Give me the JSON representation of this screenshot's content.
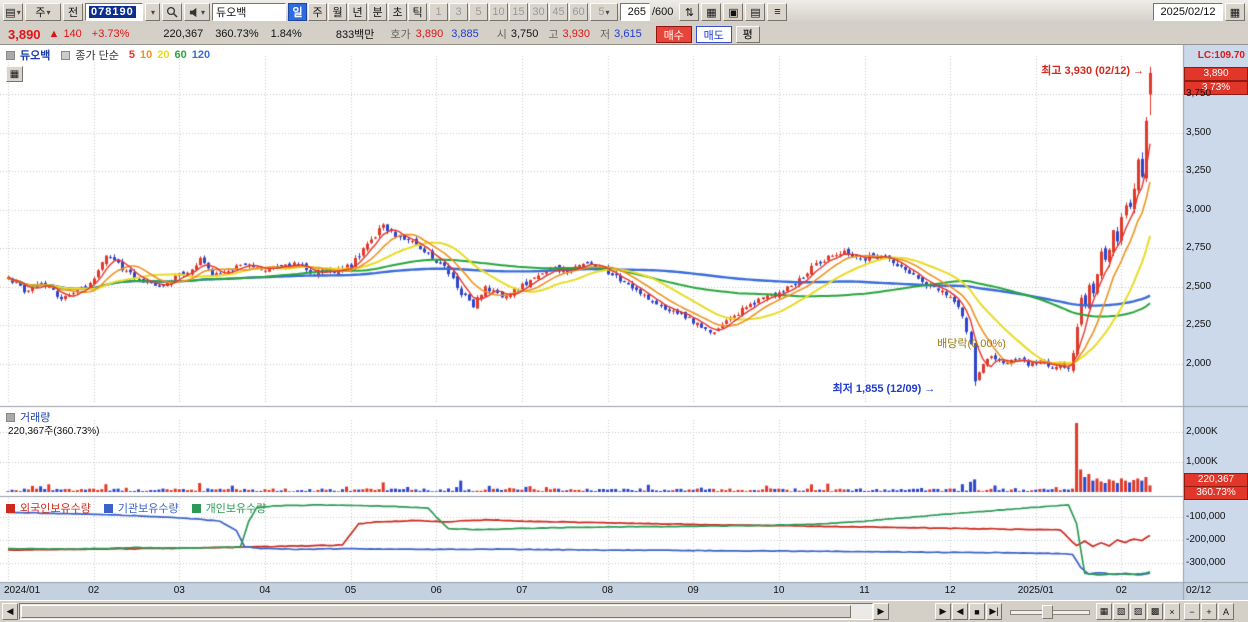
{
  "toolbar": {
    "menu_glyph": "▤",
    "period_combo": "주",
    "prev_label": "전",
    "code_value": "078190",
    "stock_name": "듀오백",
    "period_tabs": [
      {
        "label": "일",
        "active": true
      },
      {
        "label": "주",
        "active": false
      },
      {
        "label": "월",
        "active": false
      },
      {
        "label": "년",
        "active": false
      },
      {
        "label": "분",
        "active": false
      },
      {
        "label": "초",
        "active": false
      },
      {
        "label": "틱",
        "active": false
      }
    ],
    "minute_buttons": [
      "1",
      "3",
      "5",
      "10",
      "15",
      "30",
      "45",
      "60"
    ],
    "tick_count": "5",
    "bar_count": "265",
    "bar_total": "/600",
    "tool_icons": [
      {
        "glyph": "⇅",
        "name": "updown-icon"
      },
      {
        "glyph": "▦",
        "name": "chart-layout-icon"
      },
      {
        "glyph": "▣",
        "name": "save-chart-icon"
      },
      {
        "glyph": "▤",
        "name": "print-chart-icon"
      },
      {
        "glyph": "≡",
        "name": "chart-menu-icon"
      }
    ],
    "date_value": "2025/02/12",
    "calendar_glyph": "▦"
  },
  "info_bar": {
    "price": "3,890",
    "change_arrow": "▲",
    "change": "140",
    "change_pct": "+3.73%",
    "volume": "220,367",
    "volume_ratio": "360.73%",
    "turnover_pct": "1.84%",
    "amount": "833백만",
    "hoga_label": "호가",
    "ask": "3,890",
    "bid": "3,885",
    "open_label": "시",
    "open": "3,750",
    "high_label": "고",
    "high": "3,930",
    "low_label": "저",
    "low": "3,615",
    "buy_button": "매수",
    "sell_button": "매도",
    "avg_button": "평"
  },
  "chart": {
    "legend": {
      "name": "듀오백",
      "type_label": "종가 단순"
    },
    "lc_label": "LC:109.70",
    "price_badge": "3,890",
    "pct_badge": "3.73%",
    "annotations": {
      "high_label": "최고 3,930 (02/12)",
      "low_label": "최저 1,855 (12/09)",
      "dividend_label": "배당락(0.00%)",
      "arrow": "→"
    },
    "x_end_label": "02/12"
  },
  "chart_data": {
    "type": "candlestick",
    "symbol": "듀오백",
    "period": "일",
    "days": 281,
    "month_start_days": [
      0,
      21,
      42,
      63,
      84,
      105,
      126,
      147,
      168,
      189,
      210,
      231,
      252,
      273
    ],
    "x_labels": [
      "2024/01",
      "02",
      "03",
      "04",
      "05",
      "06",
      "07",
      "08",
      "09",
      "10",
      "11",
      "12",
      "2025/01",
      "02"
    ],
    "price_axis": {
      "min": 1750,
      "max": 4000,
      "ticks": [
        3750,
        3500,
        3250,
        3000,
        2750,
        2500,
        2250,
        2000
      ],
      "tick_labels": [
        "3,750",
        "3,500",
        "3,250",
        "3,000",
        "2,750",
        "2,500",
        "2,250",
        "2,000"
      ]
    },
    "price_keyframes": [
      [
        0,
        2560
      ],
      [
        4,
        2470
      ],
      [
        8,
        2530
      ],
      [
        13,
        2430
      ],
      [
        18,
        2480
      ],
      [
        21,
        2550
      ],
      [
        24,
        2700
      ],
      [
        27,
        2640
      ],
      [
        31,
        2560
      ],
      [
        36,
        2500
      ],
      [
        40,
        2540
      ],
      [
        44,
        2600
      ],
      [
        47,
        2680
      ],
      [
        50,
        2570
      ],
      [
        54,
        2610
      ],
      [
        58,
        2650
      ],
      [
        62,
        2600
      ],
      [
        66,
        2620
      ],
      [
        70,
        2650
      ],
      [
        75,
        2590
      ],
      [
        80,
        2600
      ],
      [
        84,
        2640
      ],
      [
        88,
        2780
      ],
      [
        92,
        2890
      ],
      [
        95,
        2840
      ],
      [
        99,
        2800
      ],
      [
        103,
        2720
      ],
      [
        107,
        2620
      ],
      [
        111,
        2460
      ],
      [
        114,
        2380
      ],
      [
        117,
        2500
      ],
      [
        121,
        2430
      ],
      [
        125,
        2490
      ],
      [
        129,
        2550
      ],
      [
        133,
        2620
      ],
      [
        137,
        2600
      ],
      [
        141,
        2650
      ],
      [
        145,
        2630
      ],
      [
        149,
        2560
      ],
      [
        153,
        2500
      ],
      [
        157,
        2420
      ],
      [
        161,
        2360
      ],
      [
        165,
        2320
      ],
      [
        169,
        2260
      ],
      [
        173,
        2200
      ],
      [
        177,
        2290
      ],
      [
        181,
        2370
      ],
      [
        185,
        2420
      ],
      [
        189,
        2460
      ],
      [
        193,
        2520
      ],
      [
        197,
        2620
      ],
      [
        201,
        2700
      ],
      [
        205,
        2730
      ],
      [
        209,
        2680
      ],
      [
        213,
        2700
      ],
      [
        217,
        2660
      ],
      [
        221,
        2600
      ],
      [
        225,
        2520
      ],
      [
        229,
        2460
      ],
      [
        232,
        2400
      ],
      [
        234,
        2310
      ],
      [
        236,
        2120
      ],
      [
        237,
        1880
      ],
      [
        239,
        1990
      ],
      [
        241,
        2050
      ],
      [
        244,
        2000
      ],
      [
        247,
        2040
      ],
      [
        250,
        1990
      ],
      [
        253,
        2010
      ],
      [
        256,
        1970
      ],
      [
        258,
        1990
      ],
      [
        260,
        1950
      ],
      [
        261,
        2050
      ],
      [
        262,
        2250
      ],
      [
        263,
        2420
      ],
      [
        264,
        2380
      ],
      [
        265,
        2520
      ],
      [
        266,
        2480
      ],
      [
        267,
        2600
      ],
      [
        268,
        2700
      ],
      [
        269,
        2650
      ],
      [
        270,
        2750
      ],
      [
        271,
        2850
      ],
      [
        272,
        2800
      ],
      [
        273,
        2950
      ],
      [
        274,
        3050
      ],
      [
        275,
        3000
      ],
      [
        276,
        3150
      ],
      [
        277,
        3300
      ],
      [
        278,
        3250
      ],
      [
        279,
        3550
      ],
      [
        280,
        3890
      ]
    ],
    "last_candle": {
      "open": 3750,
      "high": 3930,
      "low": 3615,
      "close": 3890
    },
    "high_point": {
      "day": 280,
      "price": 3930
    },
    "low_point": {
      "day": 237,
      "price": 1855
    },
    "dividend_point": {
      "day": 243,
      "price": 2150
    },
    "moving_averages": [
      {
        "period": 5,
        "color": "#e8342c"
      },
      {
        "period": 10,
        "color": "#f0921e"
      },
      {
        "period": 20,
        "color": "#e8dc26"
      },
      {
        "period": 60,
        "color": "#27a53c"
      },
      {
        "period": 120,
        "color": "#3a6cd8"
      }
    ],
    "candle_colors": {
      "up": "#de3a2b",
      "down": "#2e45cc"
    },
    "volume_pane": {
      "title": "거래량",
      "subtitle": "220,367주(360.73%)",
      "axis_ticks": [
        2000,
        1000
      ],
      "axis_tick_labels": [
        "2,000K",
        "1,000K"
      ],
      "badge_value": "220,367",
      "badge_ratio": "360.73%",
      "unit": "K",
      "spikes": [
        [
          24,
          260
        ],
        [
          47,
          300
        ],
        [
          92,
          320
        ],
        [
          111,
          380
        ],
        [
          157,
          240
        ],
        [
          201,
          280
        ],
        [
          234,
          260
        ],
        [
          236,
          340
        ],
        [
          237,
          420
        ],
        [
          262,
          2300
        ],
        [
          263,
          750
        ],
        [
          264,
          500
        ],
        [
          265,
          600
        ],
        [
          266,
          380
        ],
        [
          267,
          450
        ],
        [
          268,
          350
        ],
        [
          269,
          300
        ],
        [
          270,
          420
        ],
        [
          271,
          380
        ],
        [
          272,
          300
        ],
        [
          273,
          450
        ],
        [
          274,
          380
        ],
        [
          275,
          320
        ],
        [
          276,
          400
        ],
        [
          277,
          450
        ],
        [
          278,
          380
        ],
        [
          279,
          500
        ],
        [
          280,
          220
        ]
      ]
    },
    "ownership_pane": {
      "axis_ticks": [
        -100000,
        -200000,
        -300000
      ],
      "axis_tick_labels": [
        "-100,000",
        "-200,000",
        "-300,000"
      ],
      "series": [
        {
          "name": "외국인보유수량",
          "color": "#cc2a1e",
          "keyframes": [
            [
              0,
              -243000
            ],
            [
              20,
              -240000
            ],
            [
              42,
              -236000
            ],
            [
              60,
              -230000
            ],
            [
              82,
              -222000
            ],
            [
              86,
              -130000
            ],
            [
              90,
              -122000
            ],
            [
              100,
              -115000
            ],
            [
              107,
              -121000
            ],
            [
              112,
              -116000
            ],
            [
              118,
              -112000
            ],
            [
              126,
              -118000
            ],
            [
              140,
              -123000
            ],
            [
              155,
              -128000
            ],
            [
              170,
              -133000
            ],
            [
              185,
              -137000
            ],
            [
              200,
              -141000
            ],
            [
              215,
              -145000
            ],
            [
              230,
              -149000
            ],
            [
              245,
              -153000
            ],
            [
              258,
              -156000
            ],
            [
              262,
              -225000
            ],
            [
              264,
              -205000
            ],
            [
              266,
              -228000
            ],
            [
              268,
              -212000
            ],
            [
              270,
              -225000
            ],
            [
              272,
              -200000
            ],
            [
              274,
              -210000
            ],
            [
              276,
              -195000
            ],
            [
              278,
              -202000
            ],
            [
              280,
              -180000
            ]
          ]
        },
        {
          "name": "기관보유수량",
          "color": "#3a62c8",
          "keyframes": [
            [
              0,
              -80000
            ],
            [
              12,
              -84000
            ],
            [
              25,
              -90000
            ],
            [
              35,
              -97000
            ],
            [
              45,
              -108000
            ],
            [
              52,
              -118000
            ],
            [
              56,
              -160000
            ],
            [
              58,
              -228000
            ],
            [
              62,
              -236000
            ],
            [
              70,
              -240000
            ],
            [
              85,
              -238000
            ],
            [
              100,
              -241000
            ],
            [
              120,
              -240000
            ],
            [
              140,
              -243000
            ],
            [
              160,
              -245000
            ],
            [
              180,
              -247000
            ],
            [
              200,
              -249000
            ],
            [
              220,
              -252000
            ],
            [
              240,
              -255000
            ],
            [
              255,
              -258000
            ],
            [
              261,
              -262000
            ],
            [
              263,
              -320000
            ],
            [
              265,
              -348000
            ],
            [
              268,
              -342000
            ],
            [
              271,
              -350000
            ],
            [
              274,
              -346000
            ],
            [
              277,
              -352000
            ],
            [
              280,
              -345000
            ]
          ]
        },
        {
          "name": "개인보유수량",
          "color": "#2c9a54",
          "keyframes": [
            [
              0,
              -237000
            ],
            [
              15,
              -240000
            ],
            [
              30,
              -233000
            ],
            [
              45,
              -236000
            ],
            [
              57,
              -230000
            ],
            [
              59,
              -120000
            ],
            [
              61,
              -60000
            ],
            [
              65,
              -52000
            ],
            [
              75,
              -48000
            ],
            [
              85,
              -50000
            ],
            [
              95,
              -55000
            ],
            [
              103,
              -60000
            ],
            [
              105,
              -100000
            ],
            [
              108,
              -150000
            ],
            [
              115,
              -155000
            ],
            [
              125,
              -150000
            ],
            [
              140,
              -145000
            ],
            [
              155,
              -142000
            ],
            [
              170,
              -140000
            ],
            [
              185,
              -137000
            ],
            [
              200,
              -130000
            ],
            [
              210,
              -118000
            ],
            [
              220,
              -103000
            ],
            [
              230,
              -88000
            ],
            [
              240,
              -75000
            ],
            [
              250,
              -60000
            ],
            [
              256,
              -52000
            ],
            [
              260,
              -48000
            ],
            [
              262,
              -130000
            ],
            [
              263,
              -240000
            ],
            [
              264,
              -345000
            ],
            [
              268,
              -352000
            ],
            [
              272,
              -348000
            ],
            [
              276,
              -350000
            ],
            [
              279,
              -345000
            ],
            [
              280,
              -338000
            ]
          ]
        }
      ]
    }
  },
  "bottom_bar": {
    "scroll_left": "◀",
    "scroll_right": "▶",
    "playback": [
      {
        "glyph": "▶",
        "name": "play-forward-button"
      },
      {
        "glyph": "◀",
        "name": "play-backward-button"
      },
      {
        "glyph": "■",
        "name": "stop-button"
      },
      {
        "glyph": "▶|",
        "name": "step-forward-button"
      }
    ],
    "icons": [
      {
        "glyph": "▦",
        "name": "chart-type-button"
      },
      {
        "glyph": "▧",
        "name": "region-zoom-button"
      },
      {
        "glyph": "▨",
        "name": "indicator-setup-button"
      },
      {
        "glyph": "▩",
        "name": "pattern-tool-button"
      },
      {
        "glyph": "×",
        "name": "clear-tools-button"
      }
    ],
    "zoom_out": "−",
    "zoom_in": "+",
    "auto_label": "A"
  }
}
